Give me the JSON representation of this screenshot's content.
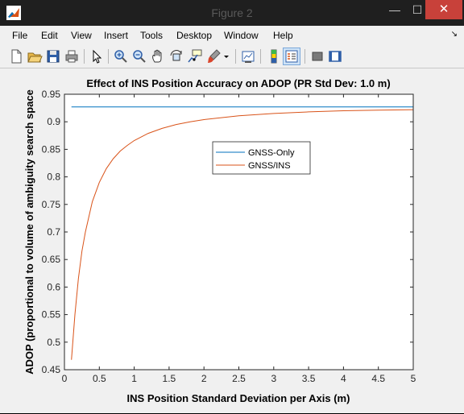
{
  "window": {
    "title": "Figure 2",
    "min_label": "—",
    "max_label": "☐",
    "close_label": "✕"
  },
  "menu": [
    "File",
    "Edit",
    "View",
    "Insert",
    "Tools",
    "Desktop",
    "Window",
    "Help"
  ],
  "menu_dock_glyph": "↘",
  "toolbar": [
    "new-figure-icon",
    "open-file-icon",
    "save-icon",
    "print-icon",
    "pointer-icon",
    "zoom-in-icon",
    "zoom-out-icon",
    "pan-icon",
    "rotate-3d-icon",
    "data-cursor-icon",
    "brush-icon",
    "link-plot-icon",
    "colorbar-icon",
    "legend-icon",
    "hide-plot-tools-icon",
    "show-plot-tools-icon"
  ],
  "chart_data": {
    "type": "line",
    "title": "Effect of INS Position Accuracy on ADOP (PR Std Dev: 1.0 m)",
    "xlabel": "INS Position Standard Deviation per Axis (m)",
    "ylabel": "ADOP  (proportional to volume of ambiguity search space",
    "xlim": [
      0,
      5
    ],
    "ylim": [
      0.45,
      0.95
    ],
    "xticks": [
      "0",
      "0.5",
      "1",
      "1.5",
      "2",
      "2.5",
      "3",
      "3.5",
      "4",
      "4.5",
      "5"
    ],
    "yticks": [
      "0.45",
      "0.5",
      "0.55",
      "0.6",
      "0.65",
      "0.7",
      "0.75",
      "0.8",
      "0.85",
      "0.9",
      "0.95"
    ],
    "grid": false,
    "legend_position": "upper-center",
    "series": [
      {
        "name": "GNSS-Only",
        "color": "#0072bd",
        "x": [
          0.1,
          5.0
        ],
        "y": [
          0.927,
          0.927
        ]
      },
      {
        "name": "GNSS/INS",
        "color": "#d95319",
        "x": [
          0.1,
          0.15,
          0.2,
          0.25,
          0.3,
          0.4,
          0.5,
          0.6,
          0.7,
          0.8,
          0.9,
          1.0,
          1.2,
          1.4,
          1.6,
          1.8,
          2.0,
          2.5,
          3.0,
          3.5,
          4.0,
          4.5,
          5.0
        ],
        "y": [
          0.468,
          0.55,
          0.615,
          0.665,
          0.7,
          0.755,
          0.79,
          0.815,
          0.833,
          0.847,
          0.857,
          0.866,
          0.879,
          0.888,
          0.895,
          0.9,
          0.904,
          0.911,
          0.915,
          0.918,
          0.92,
          0.921,
          0.922
        ]
      }
    ]
  }
}
